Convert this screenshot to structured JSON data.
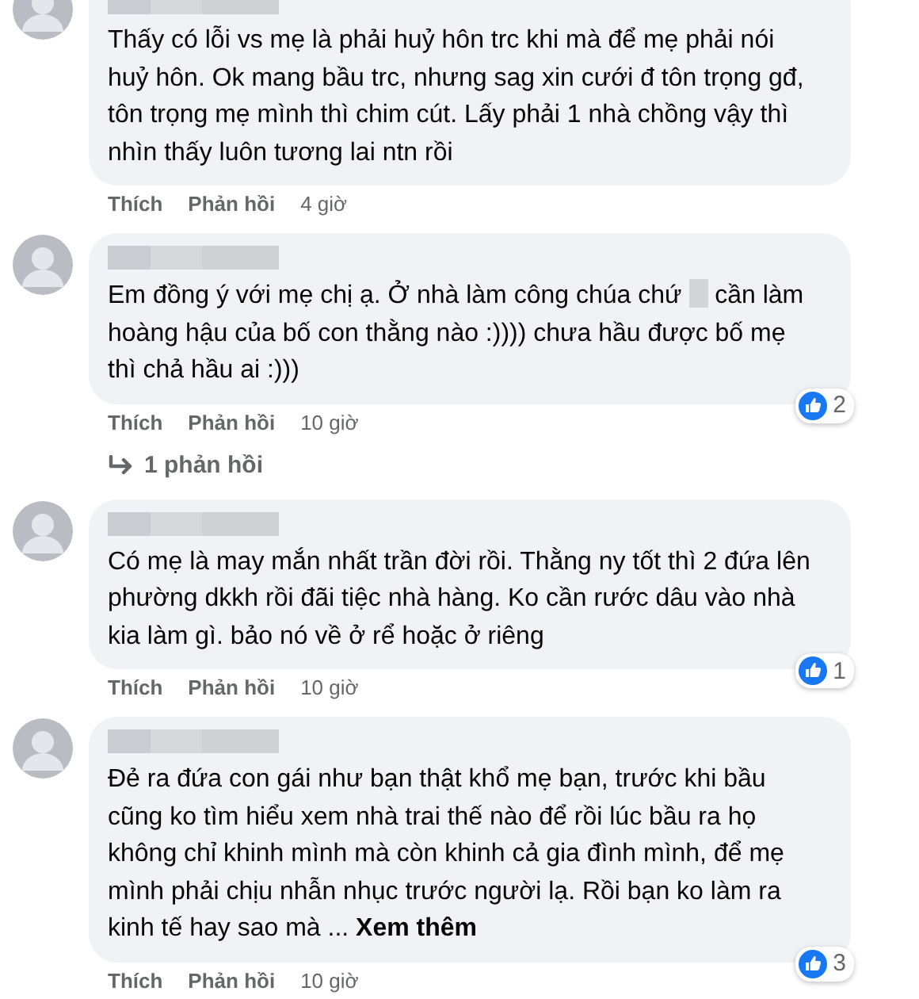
{
  "comments": [
    {
      "body": [
        {
          "kind": "text",
          "text": "Thấy có lỗi vs mẹ là phải huỷ hôn trc khi mà để mẹ phải nói huỷ hôn. Ok mang bầu trc, nhưng sag xin cưới đ tôn trọng gđ, tôn trọng mẹ mình thì chim cút. Lấy phải 1 nhà chồng vậy thì nhìn thấy luôn tương lai ntn rồi"
        }
      ],
      "like": "Thích",
      "reply": "Phản hồi",
      "time": "4 giờ"
    },
    {
      "body": [
        {
          "kind": "text",
          "text": "Em đồng ý với mẹ chị ạ. Ở nhà làm công chúa chứ "
        },
        {
          "kind": "redacted"
        },
        {
          "kind": "text",
          "text": " cần làm hoàng hậu của bố con thằng nào :)))) chưa hầu được bố mẹ thì chả hầu ai :)))"
        }
      ],
      "reactions": "2",
      "like": "Thích",
      "reply": "Phản hồi",
      "time": "10 giờ",
      "replies": "1 phản hồi"
    },
    {
      "body": [
        {
          "kind": "text",
          "text": "Có mẹ là may mắn nhất trần đời rồi. Thằng ny tốt thì 2 đứa lên phường dkkh rồi đãi tiệc nhà hàng. Ko cần rước dâu vào nhà kia làm gì. bảo nó về ở rể hoặc ở riêng"
        }
      ],
      "reactions": "1",
      "like": "Thích",
      "reply": "Phản hồi",
      "time": "10 giờ"
    },
    {
      "body": [
        {
          "kind": "text",
          "text": "Đẻ ra đứa con gái như bạn thật khổ mẹ bạn, trước khi bầu cũng ko tìm hiểu xem nhà trai thế nào để rồi lúc bầu ra họ không chỉ khinh mình mà còn khinh cả gia đình mình, để mẹ mình phải chịu nhẫn nhục trước người lạ. Rồi bạn ko làm ra kinh tế hay sao mà ... "
        },
        {
          "kind": "link",
          "text": "Xem thêm"
        }
      ],
      "reactions": "3",
      "like": "Thích",
      "reply": "Phản hồi",
      "time": "10 giờ"
    }
  ]
}
